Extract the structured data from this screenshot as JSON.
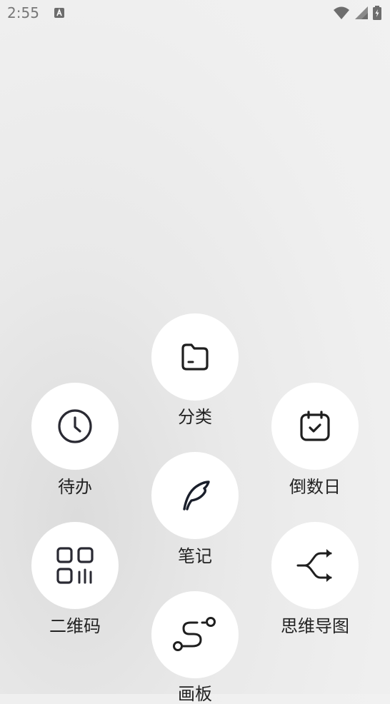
{
  "status_bar": {
    "time": "2:55"
  },
  "menu": {
    "items": [
      {
        "id": "category",
        "label": "分类",
        "icon": "folder-icon"
      },
      {
        "id": "todo",
        "label": "待办",
        "icon": "clock-icon"
      },
      {
        "id": "countdown",
        "label": "倒数日",
        "icon": "calendar-check-icon"
      },
      {
        "id": "note",
        "label": "笔记",
        "icon": "feather-icon"
      },
      {
        "id": "qrcode",
        "label": "二维码",
        "icon": "qr-code-icon"
      },
      {
        "id": "mindmap",
        "label": "思维导图",
        "icon": "shuffle-icon"
      },
      {
        "id": "canvas",
        "label": "画板",
        "icon": "route-icon"
      }
    ]
  }
}
